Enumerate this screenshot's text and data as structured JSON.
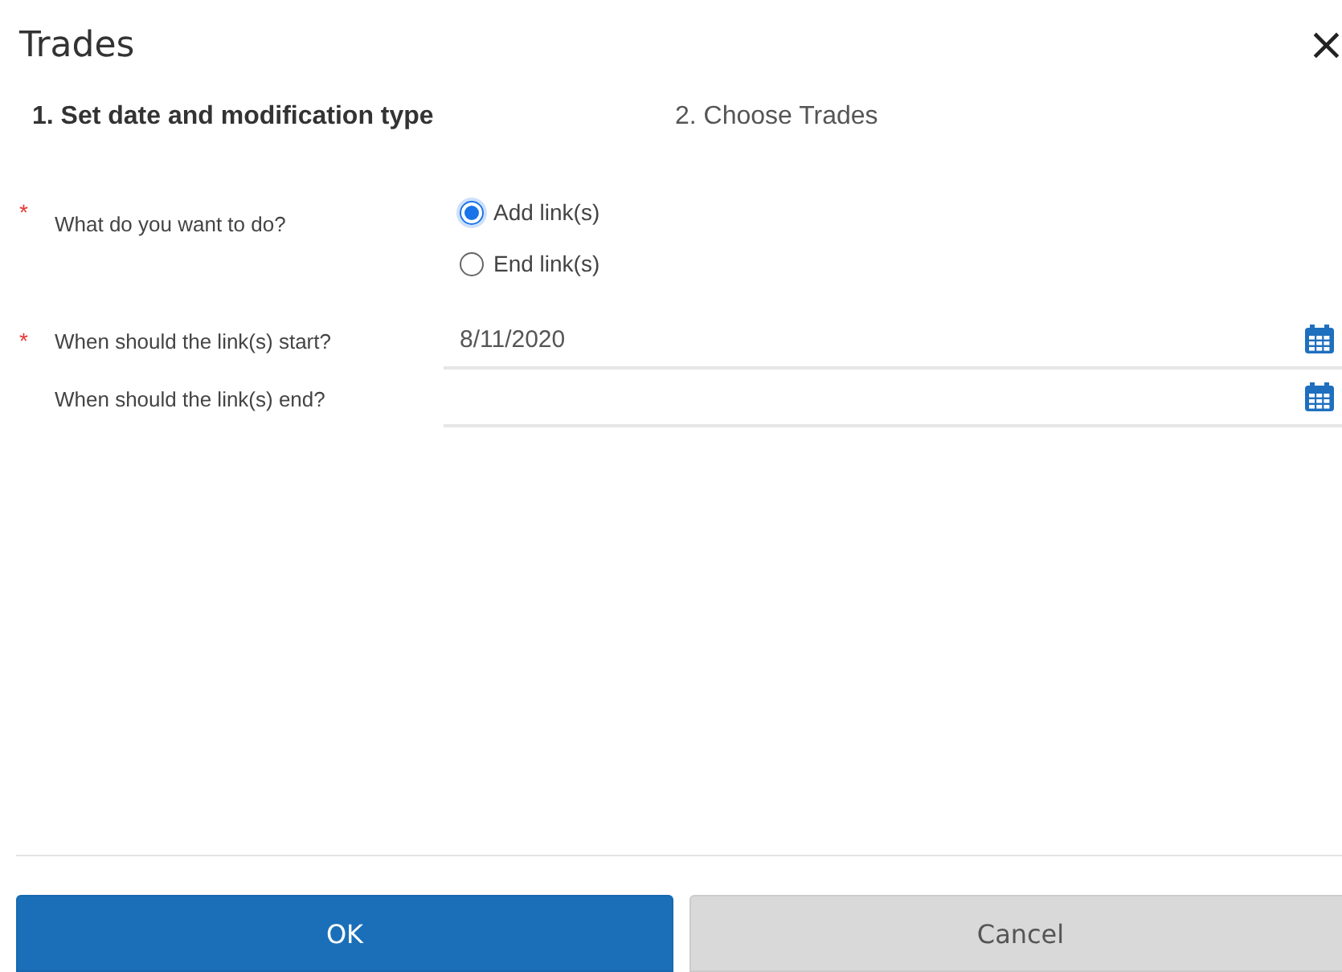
{
  "dialog": {
    "title": "Trades",
    "close": "×"
  },
  "steps": [
    {
      "label": "1. Set date and modification type",
      "selected": true
    },
    {
      "label": "2. Choose Trades",
      "selected": false
    }
  ],
  "action": {
    "label": "What do you want to do?",
    "required_mark": "*",
    "options": [
      {
        "label": "Add link(s)",
        "selected": true
      },
      {
        "label": "End link(s)",
        "selected": false
      }
    ]
  },
  "dates": [
    {
      "label": "When should the link(s) start?",
      "required_mark": "*",
      "value": "8/11/2020"
    },
    {
      "label": "When should the link(s) end?"
    }
  ],
  "buttons": [
    {
      "label": "OK",
      "kind": "primary"
    },
    {
      "label": "Cancel",
      "kind": "secondary"
    }
  ]
}
